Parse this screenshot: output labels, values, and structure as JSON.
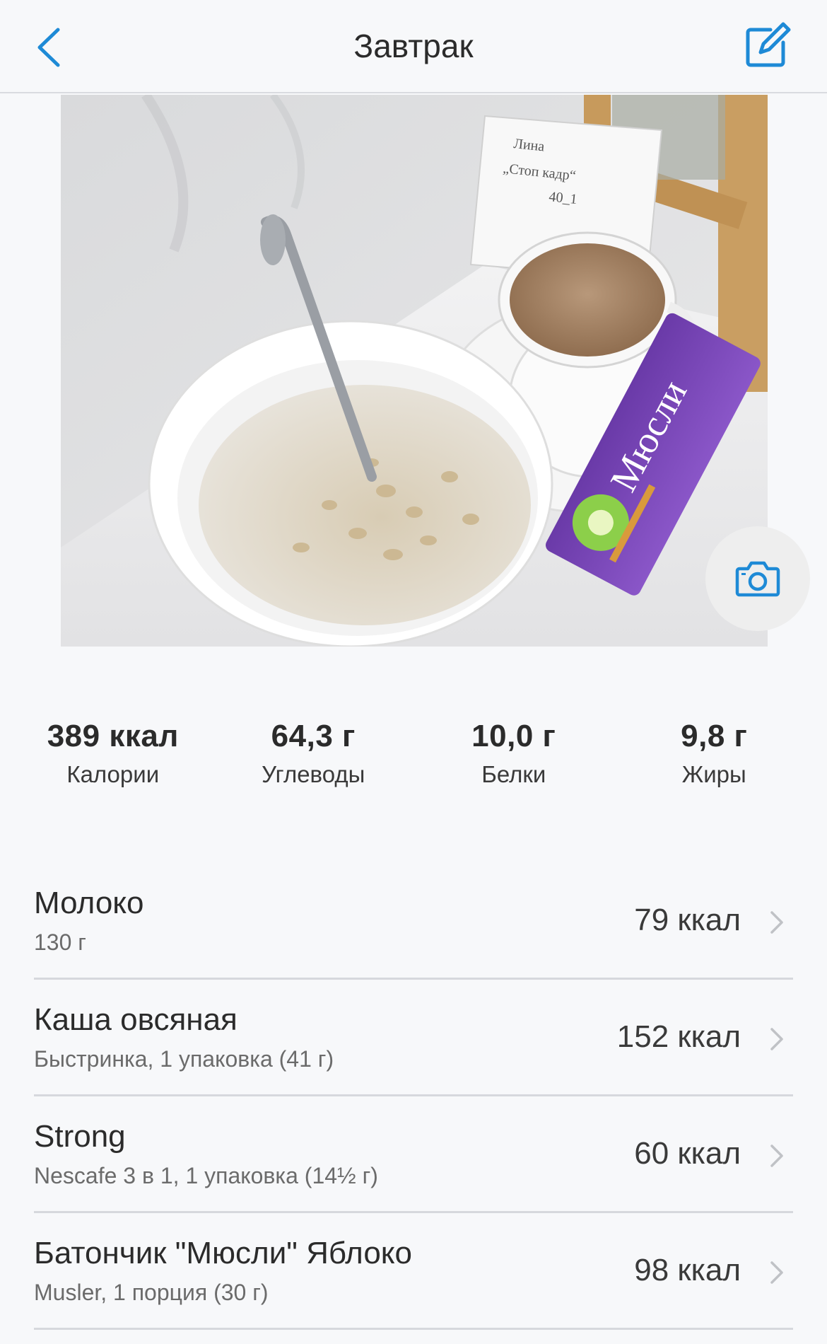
{
  "header": {
    "title": "Завтрак",
    "back_icon": "chevron-left-icon",
    "edit_icon": "edit-icon",
    "accent_color": "#1e8ad6"
  },
  "photo": {
    "note_text": [
      "Лина",
      "„Стоп кадр“",
      "40_1"
    ],
    "camera_icon": "camera-icon"
  },
  "macros": [
    {
      "value": "389 ккал",
      "label": "Калории"
    },
    {
      "value": "64,3 г",
      "label": "Углеводы"
    },
    {
      "value": "10,0 г",
      "label": "Белки"
    },
    {
      "value": "9,8 г",
      "label": "Жиры"
    }
  ],
  "foods": [
    {
      "name": "Молоко",
      "detail": "130 г",
      "kcal": "79 ккал"
    },
    {
      "name": "Каша овсяная",
      "detail": "Быстринка, 1 упаковка (41 г)",
      "kcal": "152 ккал"
    },
    {
      "name": "Strong",
      "detail": "Nescafe 3 в 1, 1 упаковка (14½ г)",
      "kcal": "60 ккал"
    },
    {
      "name": "Батончик \"Мюсли\" Яблоко",
      "detail": "Musler, 1 порция (30 г)",
      "kcal": "98 ккал"
    }
  ]
}
